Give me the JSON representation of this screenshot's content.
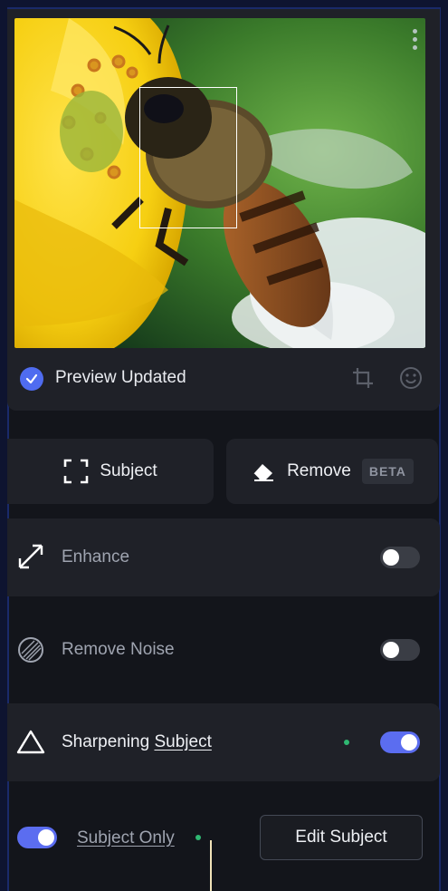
{
  "status": {
    "label": "Preview Updated"
  },
  "actions": {
    "subject_label": "Subject",
    "remove_label": "Remove",
    "remove_badge": "BETA"
  },
  "options": {
    "enhance": {
      "label": "Enhance",
      "enabled": false
    },
    "remove_noise": {
      "label": "Remove Noise",
      "enabled": false
    },
    "sharpening": {
      "label": "Sharpening",
      "link": "Subject",
      "enabled": true
    },
    "subject_only": {
      "label": "Subject Only",
      "enabled": true
    },
    "edit_subject_label": "Edit Subject"
  },
  "colors": {
    "accent": "#5b6df0",
    "status_dot": "#2fb872",
    "panel": "#1f2128",
    "background": "#13151b"
  },
  "icons": {
    "status": "check-circle-icon",
    "crop": "crop-icon",
    "face": "smile-icon",
    "subject": "focus-frame-icon",
    "remove": "eraser-icon",
    "enhance": "expand-arrows-icon",
    "remove_noise": "noise-circle-icon",
    "sharpening": "triangle-icon",
    "menu": "kebab-menu-icon"
  }
}
